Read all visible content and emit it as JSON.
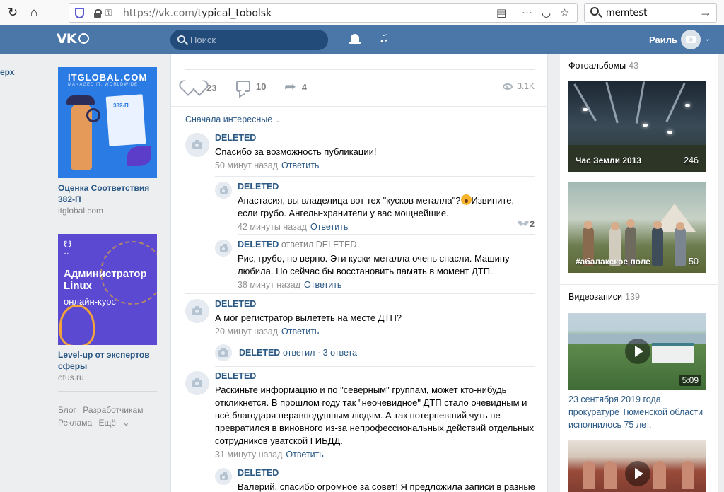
{
  "browser": {
    "url_prefix": "https://vk.com/",
    "url_path": "typical_tobolsk",
    "search_value": "memtest"
  },
  "vk_header": {
    "search_placeholder": "Поиск",
    "user_name": "Раиль"
  },
  "left": {
    "edge_label": "ерх",
    "ads": [
      {
        "brand": "ITGLOBAL.COM",
        "brand_sub": "MANAGED IT. WORLDWIDE",
        "doc_label": "382-П",
        "title": "Оценка Соответствия 382-П",
        "domain": "itglobal.com"
      },
      {
        "logo": "☋",
        "logo_dots": "• •",
        "line1": "Администратор Linux",
        "line3": "онлайн-курс",
        "title": "Level-up от экспертов сферы",
        "domain": "otus.ru"
      }
    ],
    "footer_links": [
      "Блог",
      "Разработчикам",
      "Реклама",
      "Ещё"
    ]
  },
  "post": {
    "likes": "23",
    "comments": "10",
    "shares": "4",
    "views": "3.1K",
    "sort_label": "Сначала интересные"
  },
  "comments": [
    {
      "author": "DELETED",
      "text": "Спасибо за возможность публикации!",
      "time": "50 минут назад",
      "reply": "Ответить"
    },
    {
      "author": "DELETED",
      "text_a": "Анастасия, вы владелица вот тех \"кусков металла\"?",
      "text_b": "Извините, если грубо. Ангелы-хранители у вас мощнейшие.",
      "time": "42 минуты назад",
      "reply": "Ответить",
      "likes": "2"
    },
    {
      "author": "DELETED",
      "reply_to": "ответил DELETED",
      "text": "Рис, грубо, но верно. Эти куски металла очень спасли. Машину любила. Но сейчас бы восстановить память в момент ДТП.",
      "time": "38 минут назад",
      "reply": "Ответить"
    },
    {
      "author": "DELETED",
      "text": "А мог регистратор вылететь на месте ДТП?",
      "time": "20 минут назад",
      "reply": "Ответить"
    },
    {
      "author": "DELETED",
      "text": "Раскиньте информацию и по \"северным\" группам, может кто-нибудь откликнется. В прошлом году так \"неочевидное\" ДТП стало очевидным и всё благодаря неравнодушным людям. А так потерпевший чуть не превратился в виновного из-за непрофессиональных действий отдельных сотрудников уватской ГИБДД.",
      "time": "31 минуту назад",
      "reply": "Ответить"
    },
    {
      "author": "DELETED",
      "text": "Валерий, спасибо огромное за совет! Я предложила записи в разные"
    }
  ],
  "thread": {
    "author": "DELETED",
    "action": "ответил",
    "count": "· 3 ответа"
  },
  "right": {
    "albums_title": "Фотоальбомы",
    "albums_count": "43",
    "albums": [
      {
        "caption": "Час Земли 2013",
        "count": "246"
      },
      {
        "caption": "#абалакское поле",
        "count": "50"
      }
    ],
    "videos_title": "Видеозаписи",
    "videos_count": "139",
    "video_duration": "5:09",
    "video_title": "23 сентября 2019 года прокуратуре Тюменской области исполнилось 75 лет."
  }
}
